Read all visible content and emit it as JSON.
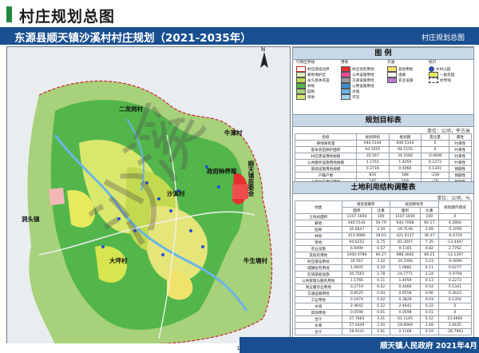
{
  "header": {
    "title": "村庄规划总图"
  },
  "plan": {
    "title": "东源县顺天镇沙溪村村庄规划（2021-2035年）",
    "subtitle": "村庄规划总图"
  },
  "map": {
    "labels": [
      "二龙岗村",
      "牛潭村",
      "顺天镇居委会",
      "政府种养殖",
      "沙溪村",
      "洞头镇",
      "大坪村",
      "牛生塘村"
    ],
    "watermark": "沙溪"
  },
  "legend": {
    "title": "图  例",
    "groups": [
      "行政区界线",
      "用地",
      "交通",
      "标识"
    ],
    "items": [
      "村庄建设边界",
      "耕地保护区",
      "永久基本农田",
      "林地",
      "园地",
      "草地",
      "村庄住宅用地",
      "公共设施用地",
      "交通设施用地",
      "公用设施用地",
      "水域",
      "河流",
      "其他用地",
      "道路",
      "农业设施",
      "乡村公园",
      "一般农田",
      "村界线"
    ]
  },
  "target_table": {
    "title": "规划目标表",
    "unit": "单位：公顷，平方米",
    "headers": [
      "指标",
      "规划目标",
      "规划期",
      "变化量",
      "属性"
    ],
    "rows": [
      [
        "耕地保有量",
        "640.5144",
        "640.5144",
        "0",
        "约束性"
      ],
      [
        "基本农田保护面积",
        "94.1555",
        "94.1555",
        "0",
        "约束性"
      ],
      [
        "村庄建设用地规模",
        "35.567",
        "34.2566",
        "-0.0696",
        "约束性"
      ],
      [
        "公共服务设施用地规模",
        "1.1761",
        "1.4059",
        "0.2273",
        "约束性"
      ],
      [
        "基础设施用地规模",
        "0.2719",
        "0.4060",
        "0.1341",
        "预期性"
      ],
      [
        "户籍户数",
        "826",
        "588",
        "-238",
        "预期性"
      ],
      [
        "人均村庄建设用地",
        "187",
        "169",
        "-19",
        "预期性"
      ]
    ]
  },
  "land_table": {
    "title": "土地利用结构调整表",
    "unit": "单位：公顷，%",
    "headers": [
      "地类",
      "规划基期年",
      "规划目标年",
      "规划期内增减"
    ],
    "subheaders": [
      "面积",
      "比重",
      "面积",
      "比重"
    ],
    "rows": [
      [
        "土地总面积",
        "1107.1694",
        "100",
        "1107.1694",
        "100",
        "0"
      ],
      [
        "耕地",
        "640.5144",
        "59.79",
        "644.7008",
        "60.17",
        "4.2864"
      ],
      [
        "园地",
        "35.6647",
        "3.30",
        "29.7146",
        "2.69",
        "-5.2095"
      ],
      [
        "林地",
        "413.9966",
        "39.61",
        "421.9137",
        "36.37",
        "-6.6729"
      ],
      [
        "草地",
        "94.6252",
        "8.75",
        "81.3047",
        "7.35",
        "-13.4447"
      ],
      [
        "农业设施",
        "6.9499",
        "0.57",
        "9.1165",
        "0.82",
        "2.7762"
      ],
      [
        "其他农用地",
        "1000.0789",
        "90.27",
        "988.3692",
        "89.25",
        "-12.1397"
      ],
      [
        "村庄建设用地",
        "35.567",
        "3.42",
        "34.2566",
        "3.23",
        "-0.0696"
      ],
      [
        "城镇住宅用地",
        "1.0605",
        "0.10",
        "1.0882",
        "0.11",
        "0.0277"
      ],
      [
        "区域基础设施",
        "30.7565",
        "2.78",
        "24.7771",
        "2.24",
        "-5.9794"
      ],
      [
        "公共管理与服务用地",
        "1.1766",
        "0.11",
        "1.4059",
        "0.13",
        "0.2273"
      ],
      [
        "商业服务业用地",
        "0.2719",
        "0.02",
        "0.4060",
        "0.04",
        "0.1341"
      ],
      [
        "交通运输用地",
        "0.8525",
        "0.04",
        "0.6558",
        "0.06",
        "0.3623"
      ],
      [
        "工业用地",
        "0.2474",
        "0.02",
        "0.3828",
        "0.03",
        "0.1354"
      ],
      [
        "水域",
        "2.4642",
        "0.22",
        "2.4642",
        "0.22",
        "0"
      ],
      [
        "其他用地",
        "0.0598",
        "0.01",
        "0.0598",
        "0.01",
        "0"
      ],
      [
        "合计",
        "37.7665",
        "3.41",
        "61.1165",
        "5.52",
        "23.4660"
      ],
      [
        "水库",
        "27.6449",
        "2.50",
        "29.6084",
        "2.68",
        "2.0635"
      ],
      [
        "合计",
        "28.9131",
        "2.61",
        "2.1168",
        "0.19",
        "-26.7963"
      ]
    ]
  },
  "footer": {
    "org": "顺天镇人民政府  2021年4月",
    "page": "1"
  }
}
